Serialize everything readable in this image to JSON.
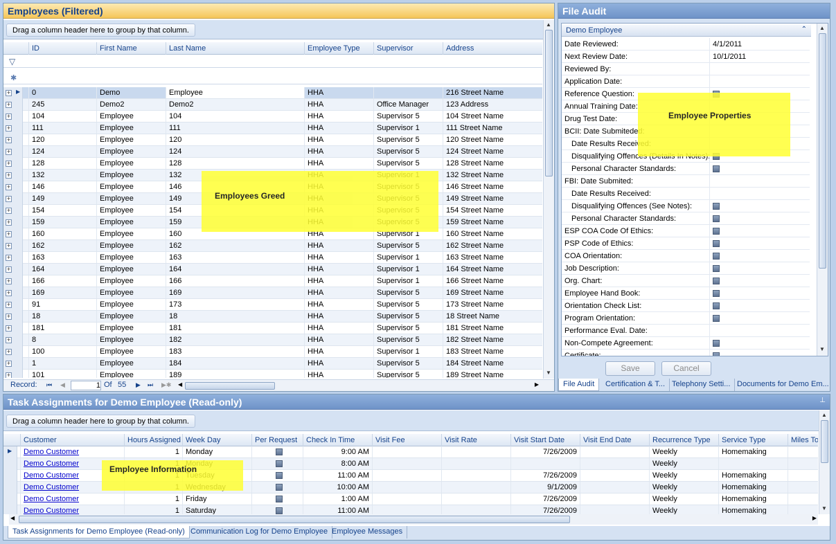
{
  "employees_panel": {
    "title": "Employees (Filtered)",
    "group_hint": "Drag a column header here to group by that column.",
    "columns": [
      "ID",
      "First Name",
      "Last Name",
      "Employee Type",
      "Supervisor",
      "Address"
    ],
    "rows": [
      [
        "0",
        "Demo",
        "Employee",
        "HHA",
        "",
        "216 Street Name"
      ],
      [
        "245",
        "Demo2",
        "Demo2",
        "HHA",
        "Office Manager",
        "123 Address"
      ],
      [
        "104",
        "Employee",
        "104",
        "HHA",
        "Supervisor 5",
        "104 Street Name"
      ],
      [
        "111",
        "Employee",
        "111",
        "HHA",
        "Supervisor 1",
        "111 Street Name"
      ],
      [
        "120",
        "Employee",
        "120",
        "HHA",
        "Supervisor 5",
        "120 Street Name"
      ],
      [
        "124",
        "Employee",
        "124",
        "HHA",
        "Supervisor 5",
        "124 Street Name"
      ],
      [
        "128",
        "Employee",
        "128",
        "HHA",
        "Supervisor 5",
        "128 Street Name"
      ],
      [
        "132",
        "Employee",
        "132",
        "HHA",
        "Supervisor 1",
        "132 Street Name"
      ],
      [
        "146",
        "Employee",
        "146",
        "HHA",
        "Supervisor 5",
        "146 Street Name"
      ],
      [
        "149",
        "Employee",
        "149",
        "HHA",
        "Supervisor 5",
        "149 Street Name"
      ],
      [
        "154",
        "Employee",
        "154",
        "HHA",
        "Supervisor 5",
        "154 Street Name"
      ],
      [
        "159",
        "Employee",
        "159",
        "HHA",
        "Supervisor 5",
        "159 Street Name"
      ],
      [
        "160",
        "Employee",
        "160",
        "HHA",
        "Supervisor 1",
        "160 Street Name"
      ],
      [
        "162",
        "Employee",
        "162",
        "HHA",
        "Supervisor 5",
        "162 Street Name"
      ],
      [
        "163",
        "Employee",
        "163",
        "HHA",
        "Supervisor 1",
        "163 Street Name"
      ],
      [
        "164",
        "Employee",
        "164",
        "HHA",
        "Supervisor 1",
        "164 Street Name"
      ],
      [
        "166",
        "Employee",
        "166",
        "HHA",
        "Supervisor 1",
        "166 Street Name"
      ],
      [
        "169",
        "Employee",
        "169",
        "HHA",
        "Supervisor 5",
        "169 Street Name"
      ],
      [
        "91",
        "Employee",
        "173",
        "HHA",
        "Supervisor 5",
        "173 Street Name"
      ],
      [
        "18",
        "Employee",
        "18",
        "HHA",
        "Supervisor 5",
        "18 Street Name"
      ],
      [
        "181",
        "Employee",
        "181",
        "HHA",
        "Supervisor 5",
        "181 Street Name"
      ],
      [
        "8",
        "Employee",
        "182",
        "HHA",
        "Supervisor 5",
        "182 Street Name"
      ],
      [
        "100",
        "Employee",
        "183",
        "HHA",
        "Supervisor 1",
        "183 Street Name"
      ],
      [
        "1",
        "Employee",
        "184",
        "HHA",
        "Supervisor 5",
        "184 Street Name"
      ],
      [
        "101",
        "Employee",
        "189",
        "HHA",
        "Supervisor 5",
        "189 Street Name"
      ]
    ],
    "navigator": {
      "label": "Record:",
      "current": "1",
      "of_label": "Of",
      "total": "55"
    },
    "annotation": "Employees Greed"
  },
  "file_audit": {
    "title": "File Audit",
    "section": "Demo Employee",
    "properties": [
      {
        "label": "Date Reviewed:",
        "value": "4/1/2011",
        "check": false,
        "indent": false
      },
      {
        "label": "Next Review Date:",
        "value": "10/1/2011",
        "check": false,
        "indent": false
      },
      {
        "label": "Reviewed By:",
        "value": "",
        "check": false,
        "indent": false
      },
      {
        "label": "Application Date:",
        "value": "",
        "check": false,
        "indent": false
      },
      {
        "label": "Reference Question:",
        "value": "",
        "check": true,
        "indent": false
      },
      {
        "label": "Annual Training Date:",
        "value": "",
        "check": false,
        "indent": false
      },
      {
        "label": "Drug Test Date:",
        "value": "",
        "check": false,
        "indent": false
      },
      {
        "label": "BCII: Date Submiteded:",
        "value": "",
        "check": false,
        "indent": false
      },
      {
        "label": "Date Results Received:",
        "value": "",
        "check": false,
        "indent": true
      },
      {
        "label": "Disqualifying Offences (Details In Notes):",
        "value": "",
        "check": true,
        "indent": true
      },
      {
        "label": "Personal Character Standards:",
        "value": "",
        "check": true,
        "indent": true
      },
      {
        "label": "FBI: Date Submited:",
        "value": "",
        "check": false,
        "indent": false
      },
      {
        "label": "Date Results Received:",
        "value": "",
        "check": false,
        "indent": true
      },
      {
        "label": "Disqualifying Offences (See Notes):",
        "value": "",
        "check": true,
        "indent": true
      },
      {
        "label": "Personal Character Standards:",
        "value": "",
        "check": true,
        "indent": true
      },
      {
        "label": "ESP COA Code Of Ethics:",
        "value": "",
        "check": true,
        "indent": false
      },
      {
        "label": "PSP Code of Ethics:",
        "value": "",
        "check": true,
        "indent": false
      },
      {
        "label": "COA Orientation:",
        "value": "",
        "check": true,
        "indent": false
      },
      {
        "label": "Job Description:",
        "value": "",
        "check": true,
        "indent": false
      },
      {
        "label": "Org. Chart:",
        "value": "",
        "check": true,
        "indent": false
      },
      {
        "label": "Employee Hand Book:",
        "value": "",
        "check": true,
        "indent": false
      },
      {
        "label": "Orientation Check List:",
        "value": "",
        "check": true,
        "indent": false
      },
      {
        "label": "Program Orientation:",
        "value": "",
        "check": true,
        "indent": false
      },
      {
        "label": "Performance Eval. Date:",
        "value": "",
        "check": false,
        "indent": false
      },
      {
        "label": "Non-Compete Agreement:",
        "value": "",
        "check": true,
        "indent": false
      },
      {
        "label": "Certificate:",
        "value": "",
        "check": true,
        "indent": false
      }
    ],
    "save_label": "Save",
    "cancel_label": "Cancel",
    "tabs": [
      "File Audit",
      "Certification & T...",
      "Telephony Setti...",
      "Documents for Demo Em..."
    ],
    "annotation": "Employee Properties"
  },
  "tasks_panel": {
    "title": "Task Assignments for Demo Employee (Read-only)",
    "group_hint": "Drag a column header here to group by that column.",
    "columns": [
      "Customer",
      "Hours Assigned",
      "Week Day",
      "Per Request",
      "Check In Time",
      "Visit Fee",
      "Visit Rate",
      "Visit Start Date",
      "Visit End Date",
      "Recurrence Type",
      "Service Type",
      "Miles To"
    ],
    "rows": [
      {
        "customer": "Demo Customer",
        "hours": "1",
        "weekday": "Monday",
        "checkin": "9:00 AM",
        "start": "7/26/2009",
        "end": "",
        "recurrence": "Weekly",
        "service": "Homemaking"
      },
      {
        "customer": "Demo Customer",
        "hours": "1",
        "weekday": "Monday",
        "checkin": "8:00 AM",
        "start": "",
        "end": "",
        "recurrence": "Weekly",
        "service": ""
      },
      {
        "customer": "Demo Customer",
        "hours": "1",
        "weekday": "Tuesday",
        "checkin": "11:00 AM",
        "start": "7/26/2009",
        "end": "",
        "recurrence": "Weekly",
        "service": "Homemaking"
      },
      {
        "customer": "Demo Customer",
        "hours": "1",
        "weekday": "Wednesday",
        "checkin": "10:00 AM",
        "start": "9/1/2009",
        "end": "",
        "recurrence": "Weekly",
        "service": "Homemaking"
      },
      {
        "customer": "Demo Customer",
        "hours": "1",
        "weekday": "Friday",
        "checkin": "1:00 AM",
        "start": "7/26/2009",
        "end": "",
        "recurrence": "Weekly",
        "service": "Homemaking"
      },
      {
        "customer": "Demo Customer",
        "hours": "1",
        "weekday": "Saturday",
        "checkin": "11:00 AM",
        "start": "7/26/2009",
        "end": "",
        "recurrence": "Weekly",
        "service": "Homemaking"
      }
    ],
    "tabs": [
      "Task Assignments for Demo Employee (Read-only)",
      "Communication Log for Demo Employee",
      "Employee Messages"
    ],
    "annotation": "Employee Information"
  },
  "colors": {
    "header_gradient_top": "#fde6a8",
    "header_gradient_bottom": "#f6c95c",
    "annotation": "#ffff33",
    "link": "#0000cc"
  }
}
